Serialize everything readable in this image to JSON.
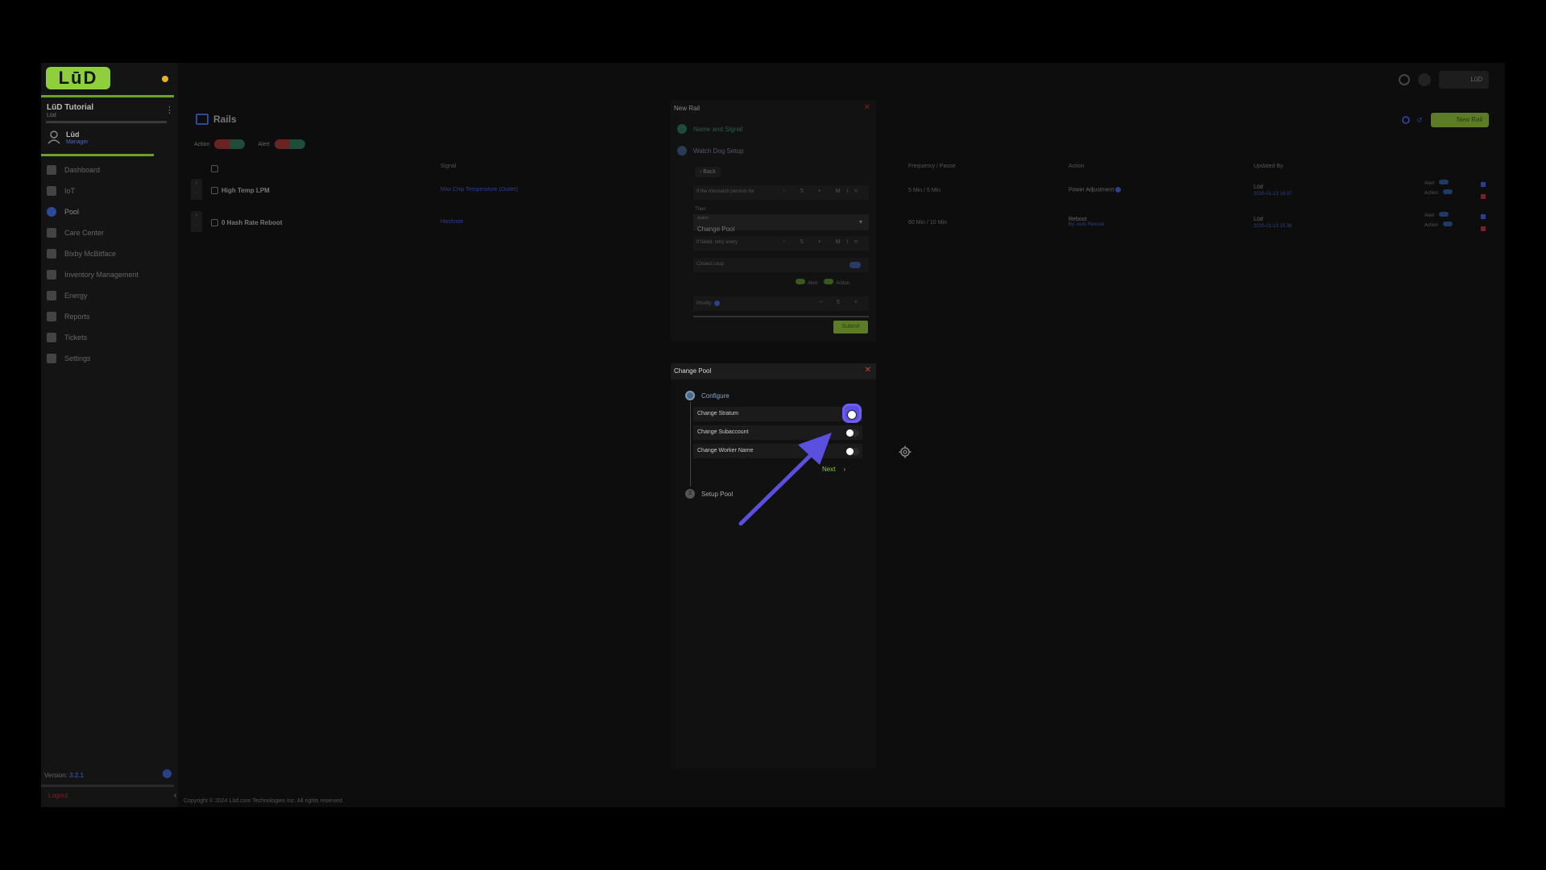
{
  "sidebar": {
    "logo_text": "LūD",
    "org_name": "LūD Tutorial",
    "org_sub": "Lūd",
    "user_name": "Lūd",
    "user_role": "Manager",
    "items": [
      {
        "label": "Dashboard",
        "icon": "dashboard-icon"
      },
      {
        "label": "IoT",
        "icon": "star-icon"
      },
      {
        "label": "Pool",
        "icon": "pool-icon"
      },
      {
        "label": "Care Center",
        "icon": "care-icon"
      },
      {
        "label": "Bixby McBitface",
        "icon": "bot-icon"
      },
      {
        "label": "Inventory Management",
        "icon": "inventory-icon"
      },
      {
        "label": "Energy",
        "icon": "bolt-icon"
      },
      {
        "label": "Reports",
        "icon": "report-icon"
      },
      {
        "label": "Tickets",
        "icon": "ticket-icon"
      },
      {
        "label": "Settings",
        "icon": "gear-icon"
      }
    ],
    "active_index": 2,
    "version_label": "Version:",
    "version_value": "3.2.1",
    "logout_label": "Logout"
  },
  "header": {
    "user_label": "LūD"
  },
  "page": {
    "title": "Rails",
    "filter_action_label": "Action",
    "filter_alert_label": "Alert",
    "new_rail_label": "New Rail"
  },
  "table": {
    "columns": [
      "Signal",
      "Frequency / Pause",
      "Action",
      "Updated By"
    ],
    "rows": [
      {
        "name": "High Temp LPM",
        "signal": "Max Chip Temperature (Outlet)",
        "frequency": "5 Min / 5 Min",
        "action": "Power Adjustment",
        "action_sub": "",
        "updated_by": "Lūd",
        "updated_at": "2025-01-13 16:07",
        "alert_label": "Alert",
        "action_label": "Action"
      },
      {
        "name": "0 Hash Rate Reboot",
        "signal": "Hashrate",
        "frequency": "60 Min / 10 Min",
        "action": "Reboot",
        "action_sub": "By: Auto Rescue",
        "updated_by": "Lūd",
        "updated_at": "2025-01-13 15:38",
        "alert_label": "Alert",
        "action_label": "Action"
      }
    ]
  },
  "footer": {
    "copyright": "Copyright © 2024 Lūd.com Technologies Inc. All rights reserved."
  },
  "new_rail_dialog": {
    "title": "New Rail",
    "step1": "Name and Signal",
    "step2": "Watch Dog Setup",
    "back_label": "Back",
    "mismatch_label": "If the mismatch persists for",
    "mismatch_value": "5",
    "mismatch_unit": "Min",
    "then_label": "Then",
    "action_small": "Action",
    "action_value": "Change Pool",
    "retry_label": "If failed, retry every",
    "retry_value": "5",
    "retry_unit": "Min",
    "closed_loop_label": "Closed Loop",
    "alert_label": "Alert",
    "action_label": "Action",
    "priority_label": "Priority",
    "priority_value": "5",
    "submit_label": "Submit"
  },
  "change_pool_dialog": {
    "title": "Change Pool",
    "step1": "Configure",
    "step2_index": "2",
    "step2": "Setup Pool",
    "options": [
      {
        "label": "Change Stratum",
        "checked": false,
        "highlighted": true
      },
      {
        "label": "Change Subaccount",
        "checked": false,
        "highlighted": false
      },
      {
        "label": "Change Worker Name",
        "checked": false,
        "highlighted": false
      }
    ],
    "next_label": "Next",
    "next_icon": "chevron-right-icon"
  },
  "colors": {
    "accent_green": "#8fcf3d",
    "highlight_purple": "#5b4fe0",
    "close_red": "#d04040"
  }
}
